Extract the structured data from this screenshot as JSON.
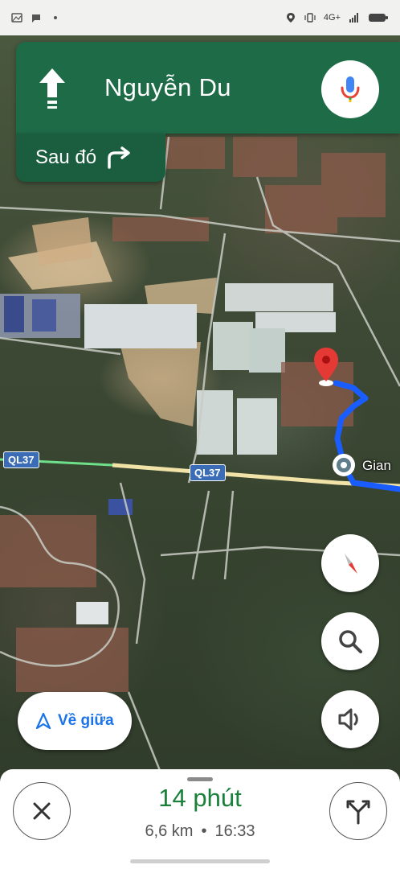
{
  "status_bar": {
    "network": "4G+",
    "icons": [
      "gallery-icon",
      "message-icon",
      "more-icon",
      "location-icon",
      "vibrate-icon",
      "signal-icon",
      "battery-icon"
    ]
  },
  "navigation": {
    "maneuver_icon": "straight-arrow-icon",
    "street": "Nguyễn Du",
    "then_label": "Sau đó",
    "then_icon": "turn-right-icon",
    "colors": {
      "primary": "#1e6b47",
      "secondary": "#1b5e3f"
    }
  },
  "map": {
    "road_labels": [
      "QL37",
      "QL37"
    ],
    "place_label": "Gian",
    "route_color": "#1a5dff"
  },
  "controls": {
    "recenter_label": "Về giữa",
    "compass_icon": "compass-icon",
    "search_icon": "search-icon",
    "sound_icon": "sound-icon"
  },
  "trip": {
    "duration": "14 phút",
    "distance": "6,6 km",
    "separator": "•",
    "arrival": "16:33",
    "duration_color": "#188038"
  }
}
